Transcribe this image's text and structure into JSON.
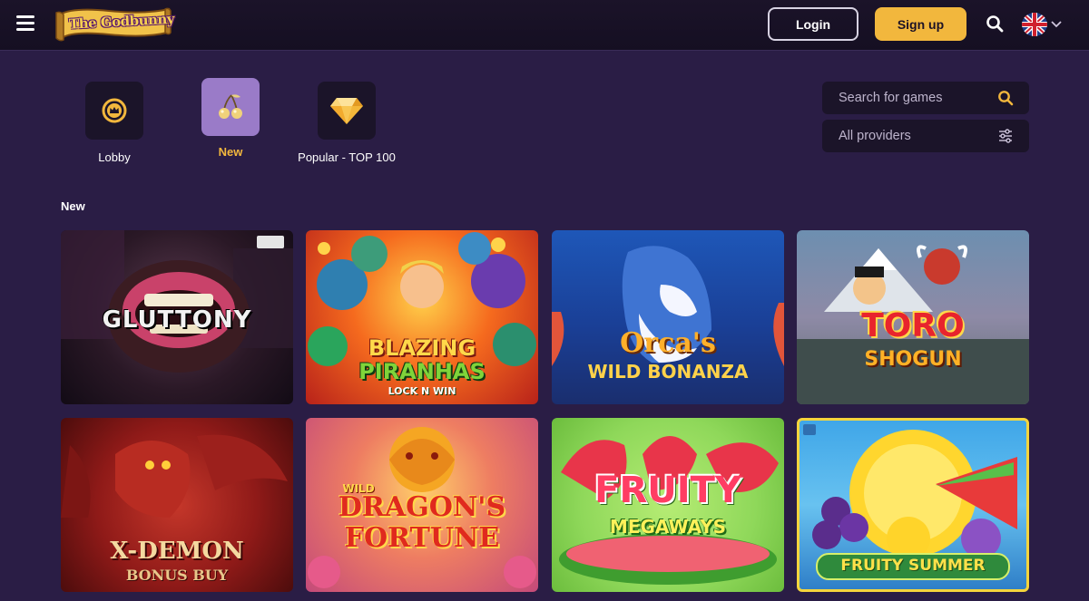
{
  "header": {
    "logo_text": "The Godbunny",
    "login_label": "Login",
    "signup_label": "Sign up",
    "language_flag": "uk-flag-icon",
    "icons": [
      "menu-icon",
      "search-icon",
      "chevron-down-icon"
    ]
  },
  "categories": [
    {
      "label": "Lobby",
      "icon": "crown-icon",
      "active": false
    },
    {
      "label": "New",
      "icon": "cherries-icon",
      "active": true
    },
    {
      "label": "Popular - TOP 100",
      "icon": "diamond-icon",
      "active": false
    }
  ],
  "search": {
    "placeholder": "Search for games"
  },
  "providers": {
    "label": "All providers"
  },
  "section": {
    "title": "New"
  },
  "games": [
    {
      "title_line1": "GLUTTONY",
      "title_line2": "",
      "title_line3": ""
    },
    {
      "title_line1": "BLAZING",
      "title_line2": "PIRANHAS",
      "title_line3": "LOCK N WIN"
    },
    {
      "title_line1": "Orca's",
      "title_line2": "WILD BONANZA",
      "title_line3": ""
    },
    {
      "title_line1": "TORO",
      "title_line2": "SHOGUN",
      "title_line3": ""
    },
    {
      "title_line1": "X-DEMON",
      "title_line2": "BONUS BUY",
      "title_line3": ""
    },
    {
      "title_line1": "WILD",
      "title_line2": "DRAGON'S",
      "title_line3": "FORTUNE"
    },
    {
      "title_line1": "FRUITY",
      "title_line2": "MEGAWAYS",
      "title_line3": ""
    },
    {
      "title_line1": "FRUITY SUMMER",
      "title_line2": "",
      "title_line3": ""
    }
  ],
  "colors": {
    "background": "#2a1d45",
    "header": "#150f22",
    "accent_gold": "#f2b73d",
    "tile_dark": "#1b1429",
    "tile_active": "#9a7bc8"
  }
}
